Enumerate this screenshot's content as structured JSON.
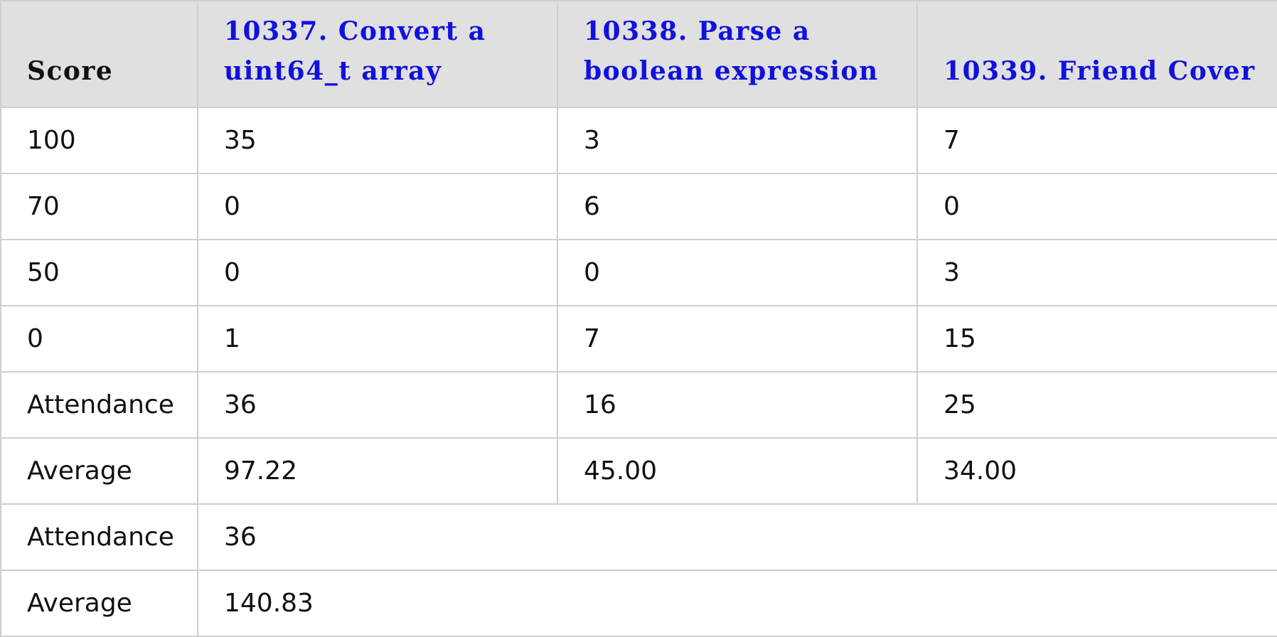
{
  "table": {
    "header": {
      "score_label": "Score",
      "problems": [
        {
          "label": "10337. Convert a uint64_t array",
          "line1": "10337. Convert a",
          "line2": "uint64_t array"
        },
        {
          "label": "10338. Parse a boolean expression",
          "line1": "10338. Parse a",
          "line2": "boolean expression"
        },
        {
          "label": "10339. Friend Cover",
          "line1": "",
          "line2": "10339. Friend Cover"
        }
      ]
    },
    "rows": [
      {
        "label": "100",
        "values": [
          "35",
          "3",
          "7"
        ]
      },
      {
        "label": "70",
        "values": [
          "0",
          "6",
          "0"
        ]
      },
      {
        "label": "50",
        "values": [
          "0",
          "0",
          "3"
        ]
      },
      {
        "label": "0",
        "values": [
          "1",
          "7",
          "15"
        ]
      },
      {
        "label": "Attendance",
        "values": [
          "36",
          "16",
          "25"
        ]
      },
      {
        "label": "Average",
        "values": [
          "97.22",
          "45.00",
          "34.00"
        ]
      }
    ],
    "summary": [
      {
        "label": "Attendance",
        "value": "36"
      },
      {
        "label": "Average",
        "value": "140.83"
      }
    ]
  }
}
